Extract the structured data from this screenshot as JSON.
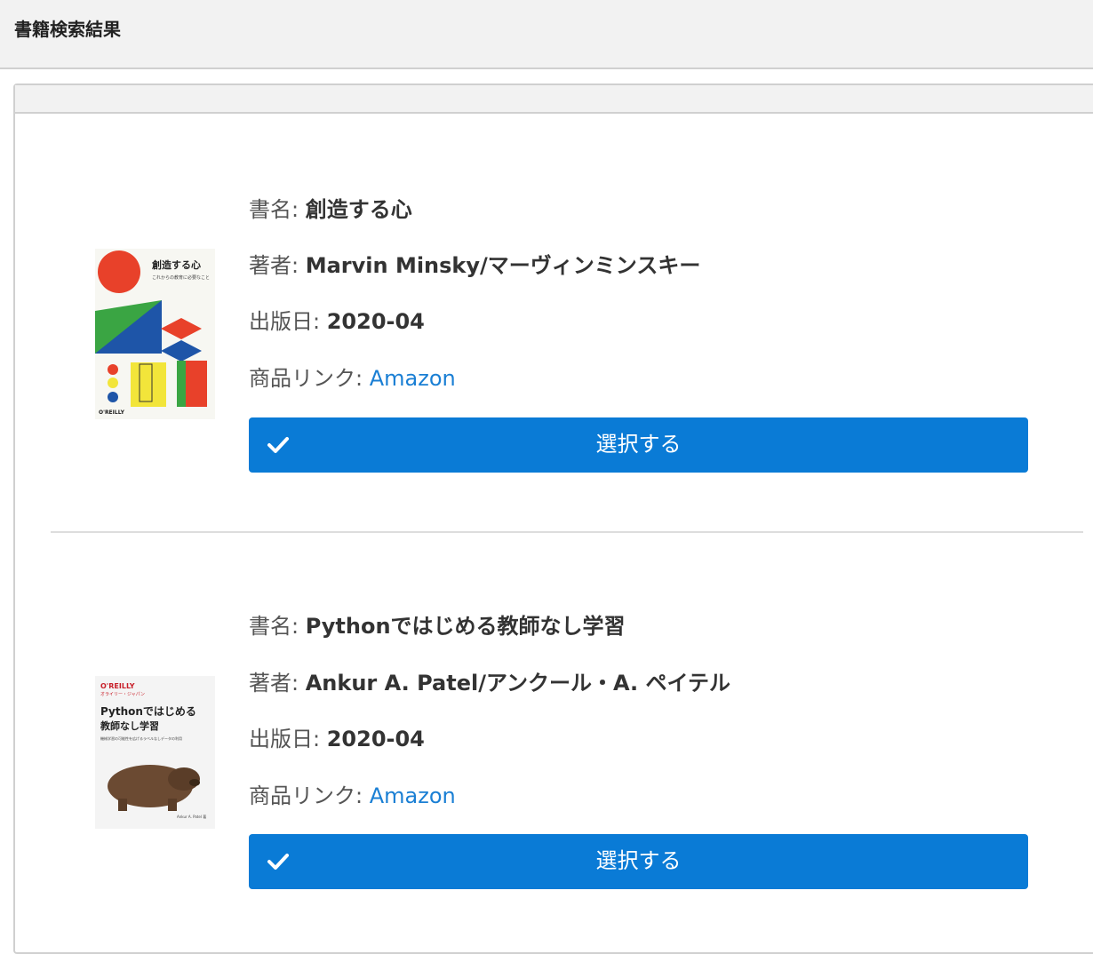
{
  "header": {
    "title": "書籍検索結果"
  },
  "books": [
    {
      "title_label": "書名: ",
      "title": "創造する心",
      "author_label": "著者: ",
      "author": "Marvin Minsky/マーヴィンミンスキー",
      "date_label": "出版日: ",
      "date": "2020-04",
      "link_label": "商品リンク: ",
      "link_text": "Amazon",
      "select_label": "選択する",
      "cover": {
        "title": "創造する心",
        "subtitle": "これからの教育に必要なこと",
        "publisher": "O'REILLY",
        "colors": {
          "red": "#e8412a",
          "blue": "#1e55a8",
          "green": "#3aa543",
          "yellow": "#f2e53a",
          "bg": "#f7f7f2"
        }
      }
    },
    {
      "title_label": "書名: ",
      "title": "Pythonではじめる教師なし学習",
      "author_label": "著者: ",
      "author": "Ankur A. Patel/アンクール・A. ペイテル",
      "date_label": "出版日: ",
      "date": "2020-04",
      "link_label": "商品リンク: ",
      "link_text": "Amazon",
      "select_label": "選択する",
      "cover": {
        "publisher": "O'REILLY",
        "publisher_sub": "オライリー・ジャパン",
        "title_line1": "Pythonではじめる",
        "title_line2": "教師なし学習",
        "subtitle": "機械学習の可能性を広げるラベルなしデータの利用",
        "author": "Ankur A. Patel 著",
        "colors": {
          "red": "#c8202a",
          "animal": "#6b4a32",
          "bg": "#f4f4f4"
        }
      }
    }
  ],
  "colors": {
    "accent": "#0a7bd6",
    "link": "#1a7fd4"
  },
  "icons": {
    "select_icon": "check-icon"
  }
}
